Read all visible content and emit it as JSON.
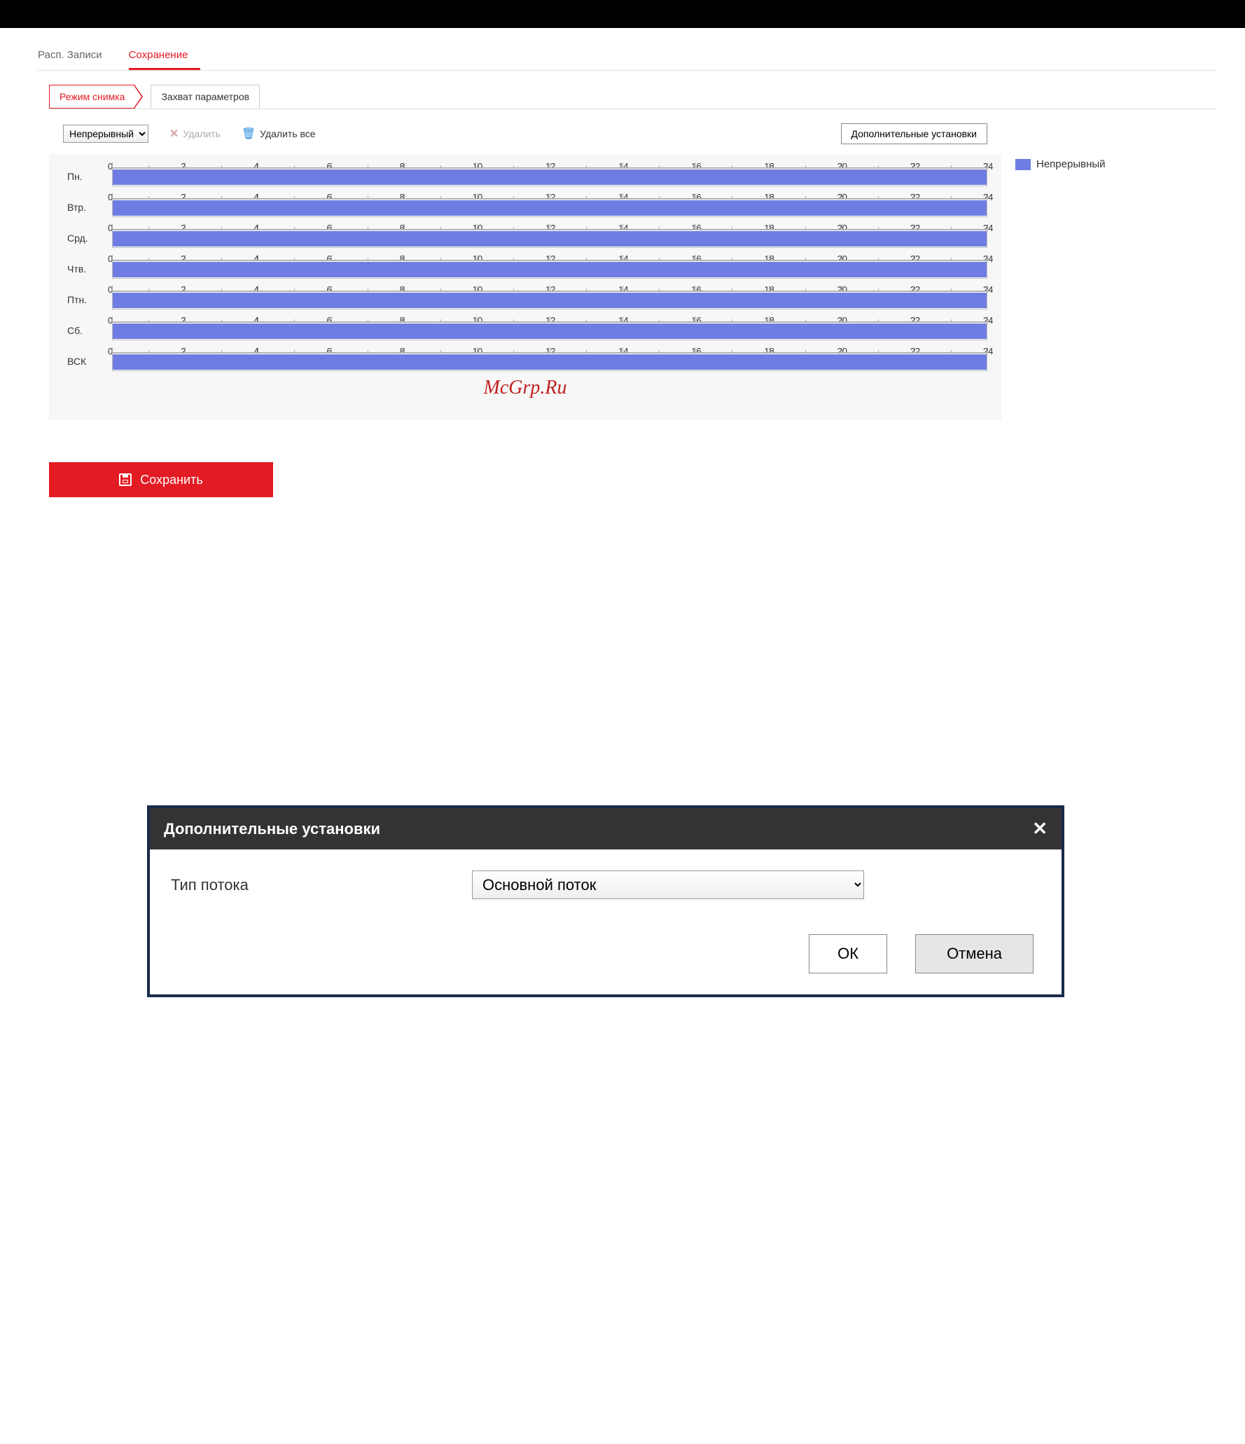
{
  "colors": {
    "accent": "#e31b23",
    "bar": "#6f7de3"
  },
  "main_tabs": {
    "schedule": "Расп. Записи",
    "storage": "Сохранение"
  },
  "sub_tabs": {
    "snapshot_mode": "Режим снимка",
    "capture_params": "Захват параметров"
  },
  "toolbar": {
    "mode_select": "Непрерывный",
    "delete": "Удалить",
    "delete_all": "Удалить все",
    "advanced": "Дополнительные установки"
  },
  "legend": {
    "continuous": "Непрерывный"
  },
  "hours": [
    "0",
    "2",
    "4",
    "6",
    "8",
    "10",
    "12",
    "14",
    "16",
    "18",
    "20",
    "22",
    "24"
  ],
  "days": [
    {
      "label": "Пн.",
      "start": 0,
      "end": 24
    },
    {
      "label": "Втр.",
      "start": 0,
      "end": 24
    },
    {
      "label": "Срд.",
      "start": 0,
      "end": 24
    },
    {
      "label": "Чтв.",
      "start": 0,
      "end": 24
    },
    {
      "label": "Птн.",
      "start": 0,
      "end": 24
    },
    {
      "label": "Сб.",
      "start": 0,
      "end": 24
    },
    {
      "label": "ВСК",
      "start": 0,
      "end": 24
    }
  ],
  "watermark": "McGrp.Ru",
  "save_label": "Сохранить",
  "dialog": {
    "title": "Дополнительные установки",
    "stream_label": "Тип потока",
    "stream_value": "Основной поток",
    "ok": "ОК",
    "cancel": "Отмена"
  },
  "chart_data": {
    "type": "bar",
    "note": "Weekly 24-hour schedule; each day fully filled 0–24 as Continuous",
    "x_range": [
      0,
      24
    ],
    "x_ticks": [
      0,
      2,
      4,
      6,
      8,
      10,
      12,
      14,
      16,
      18,
      20,
      22,
      24
    ],
    "series": [
      {
        "name": "Пн.",
        "ranges": [
          [
            0,
            24
          ]
        ]
      },
      {
        "name": "Втр.",
        "ranges": [
          [
            0,
            24
          ]
        ]
      },
      {
        "name": "Срд.",
        "ranges": [
          [
            0,
            24
          ]
        ]
      },
      {
        "name": "Чтв.",
        "ranges": [
          [
            0,
            24
          ]
        ]
      },
      {
        "name": "Птн.",
        "ranges": [
          [
            0,
            24
          ]
        ]
      },
      {
        "name": "Сб.",
        "ranges": [
          [
            0,
            24
          ]
        ]
      },
      {
        "name": "ВСК",
        "ranges": [
          [
            0,
            24
          ]
        ]
      }
    ],
    "legend": [
      "Непрерывный"
    ]
  }
}
